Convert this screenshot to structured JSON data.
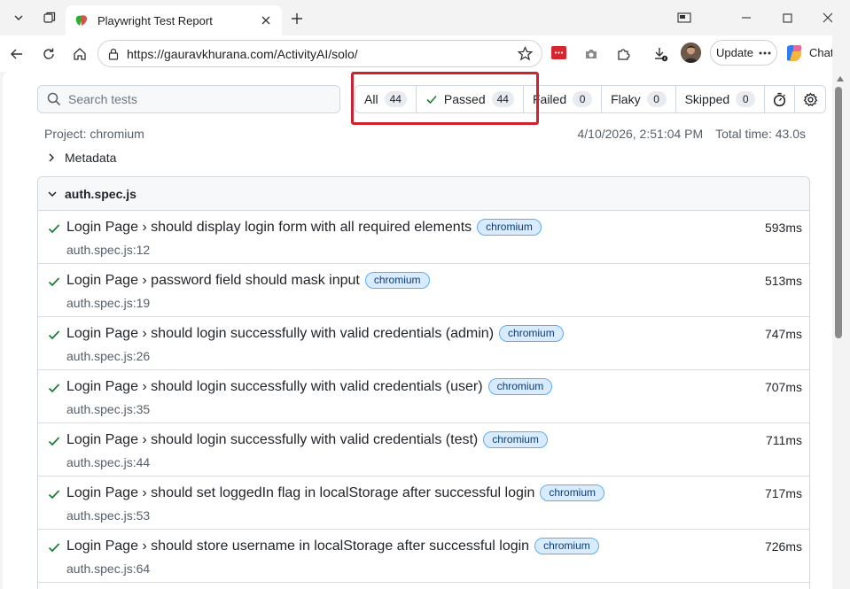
{
  "browser": {
    "tab_title": "Playwright Test Report",
    "url": "https://gauravkhurana.com/ActivityAI/solo/",
    "update_label": "Update",
    "chat_label": "Chat"
  },
  "report": {
    "search_placeholder": "Search tests",
    "filters": [
      {
        "label": "All",
        "count": "44"
      },
      {
        "label": "Passed",
        "count": "44"
      },
      {
        "label": "Failed",
        "count": "0"
      },
      {
        "label": "Flaky",
        "count": "0"
      },
      {
        "label": "Skipped",
        "count": "0"
      }
    ],
    "project": "Project: chromium",
    "date": "4/10/2026, 2:51:04 PM",
    "total_time": "Total time: 43.0s",
    "metadata_label": "Metadata",
    "suite_file": "auth.spec.js",
    "tests": [
      {
        "title": "Login Page › should display login form with all required elements",
        "tag": "chromium",
        "location": "auth.spec.js:12",
        "duration": "593ms"
      },
      {
        "title": "Login Page › password field should mask input",
        "tag": "chromium",
        "location": "auth.spec.js:19",
        "duration": "513ms"
      },
      {
        "title": "Login Page › should login successfully with valid credentials (admin)",
        "tag": "chromium",
        "location": "auth.spec.js:26",
        "duration": "747ms"
      },
      {
        "title": "Login Page › should login successfully with valid credentials (user)",
        "tag": "chromium",
        "location": "auth.spec.js:35",
        "duration": "707ms"
      },
      {
        "title": "Login Page › should login successfully with valid credentials (test)",
        "tag": "chromium",
        "location": "auth.spec.js:44",
        "duration": "711ms"
      },
      {
        "title": "Login Page › should set loggedIn flag in localStorage after successful login",
        "tag": "chromium",
        "location": "auth.spec.js:53",
        "duration": "717ms"
      },
      {
        "title": "Login Page › should store username in localStorage after successful login",
        "tag": "chromium",
        "location": "auth.spec.js:64",
        "duration": "726ms"
      }
    ]
  },
  "colors": {
    "pass_green": "#1a7f37",
    "highlight_red": "#d0212f",
    "tag_blue": "#54aeff"
  }
}
